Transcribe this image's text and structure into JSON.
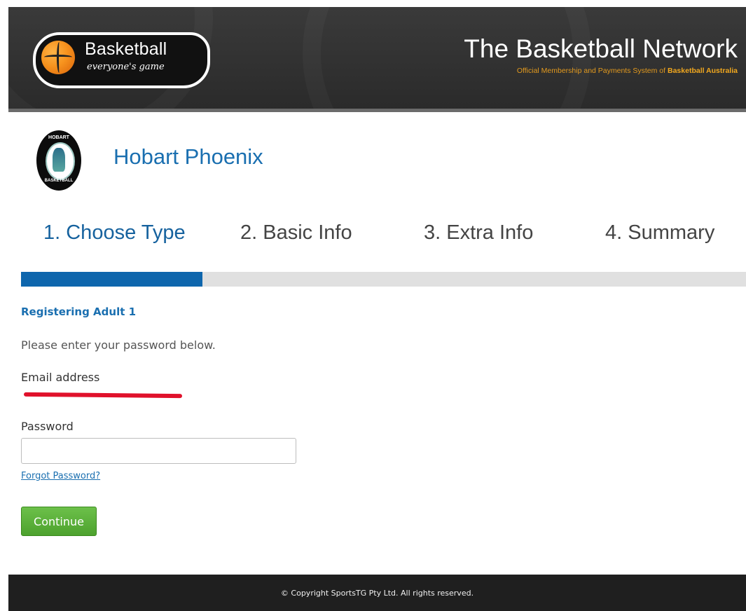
{
  "header": {
    "logo_title": "Basketball",
    "logo_tagline": "everyone's game",
    "network_title": "The Basketball Network",
    "network_subtitle_prefix": "Official Membership and Payments System of",
    "network_subtitle_brand": "Basketball Australia"
  },
  "club": {
    "badge_top": "HOBART",
    "badge_bottom": "BASKETBALL",
    "name": "Hobart Phoenix"
  },
  "steps": [
    {
      "label": "1. Choose Type",
      "active": true
    },
    {
      "label": "2. Basic Info",
      "active": false
    },
    {
      "label": "3. Extra Info",
      "active": false
    },
    {
      "label": "4. Summary",
      "active": false
    }
  ],
  "progress": {
    "fraction": 0.25
  },
  "form": {
    "heading": "Registering Adult 1",
    "intro": "Please enter your password below.",
    "email_label": "Email address",
    "email_value": "",
    "password_label": "Password",
    "password_value": "",
    "forgot_link": "Forgot Password?",
    "continue_label": "Continue"
  },
  "footer": {
    "copyright": "©  Copyright SportsTG Pty Ltd. All rights reserved."
  },
  "colors": {
    "accent_blue": "#1a6fb0",
    "progress_blue": "#0e66ad",
    "button_green": "#4da22e",
    "header_dark": "#2e2e2e",
    "subtitle_orange": "#e39a1e",
    "redaction_red": "#e0112b"
  }
}
